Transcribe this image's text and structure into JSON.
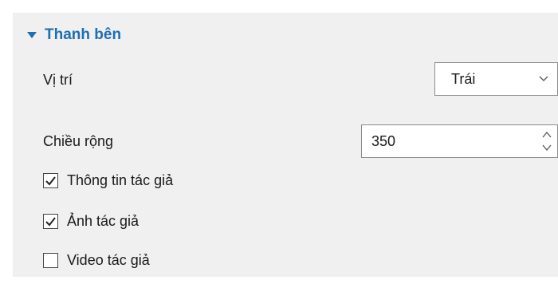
{
  "section": {
    "title": "Thanh bên",
    "expanded": true
  },
  "position": {
    "label": "Vị trí",
    "value": "Trái"
  },
  "width": {
    "label": "Chiều rộng",
    "value": "350"
  },
  "checkboxes": [
    {
      "label": "Thông tin tác giả",
      "checked": true
    },
    {
      "label": "Ảnh tác giả",
      "checked": true
    },
    {
      "label": "Video tác giả",
      "checked": false
    }
  ],
  "colors": {
    "accent": "#1f6fb2",
    "panel_bg": "#f0f0f0"
  }
}
